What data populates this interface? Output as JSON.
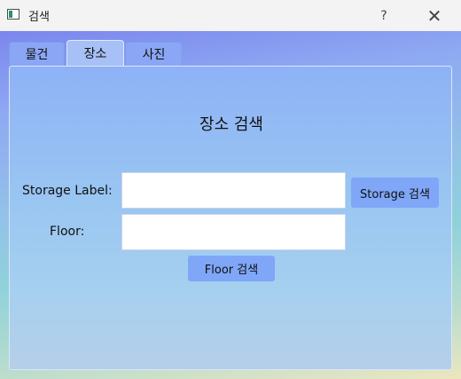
{
  "window": {
    "title": "검색",
    "help_label": "?",
    "close_label": "✕"
  },
  "tabs": [
    {
      "label": "물건",
      "selected": false
    },
    {
      "label": "장소",
      "selected": true
    },
    {
      "label": "사진",
      "selected": false
    }
  ],
  "panel": {
    "title": "장소 검색",
    "storage_label": "Storage Label:",
    "storage_value": "",
    "storage_button": "Storage 검색",
    "floor_label": "Floor:",
    "floor_value": "",
    "floor_button": "Floor 검색"
  }
}
